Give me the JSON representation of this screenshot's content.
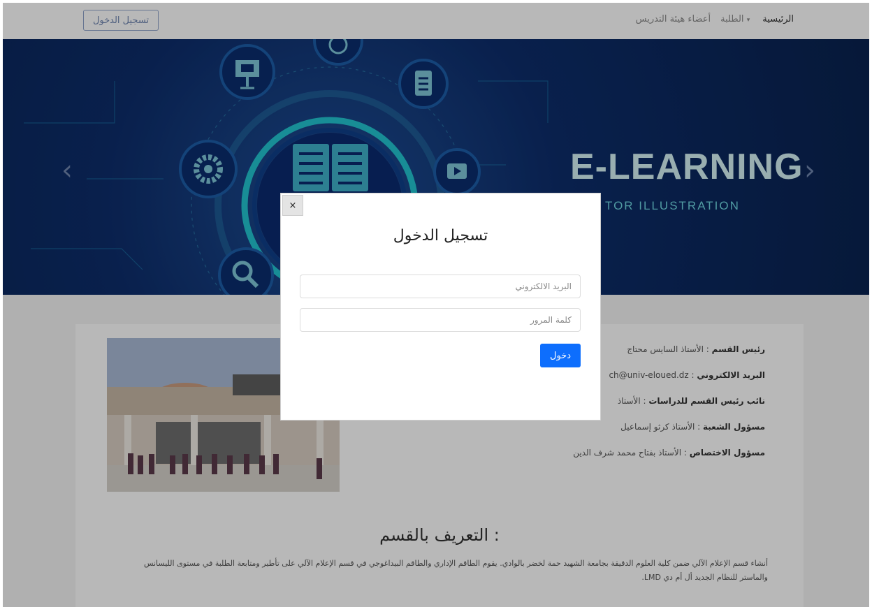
{
  "navbar": {
    "login_label": "تسجيل الدخول",
    "links": [
      {
        "label": "الرئيسية"
      },
      {
        "label": "الطلبة"
      },
      {
        "label": "أعضاء هيئة التدريس"
      }
    ],
    "caret": "▾"
  },
  "banner": {
    "title": "E-LEARNING",
    "subtitle": "TOR ILLUSTRATION",
    "prev_arrow": "‹",
    "next_arrow": "›"
  },
  "staff": [
    {
      "role": "رئيس القسم",
      "value": " : الأستاذ السايس محتاج"
    },
    {
      "role": "البريد الالكتروني",
      "value": " : ch@univ-eloued.dz"
    },
    {
      "role": "نائب رئيس القسم للدراسات",
      "value": " : الأستاذ"
    },
    {
      "role": "مسؤول الشعبة",
      "value": " : الأستاذ كرثو إسماعيل"
    },
    {
      "role": "مسؤول الاختصاص",
      "value": " : الأستاذ بفتاح محمد شرف الدين"
    }
  ],
  "about": {
    "title": "التعريف بالقسم :",
    "text": "أنشاء قسم الإعلام الآلي ضمن كلية العلوم الدقيقة بجامعة الشهيد حمة لخضر بالوادي. يقوم الطاقم الإداري والطاقم البيداغوجي في قسم الإعلام الآلي على تأطير ومتابعة الطلبة في مستوى الليسانس والماستر للنظام الجديد أل أم دي LMD."
  },
  "modal": {
    "close_glyph": "×",
    "title": "تسجيل الدخول",
    "email_placeholder": "البريد الالكتروني",
    "email_value": "",
    "password_placeholder": "كلمة المرور",
    "password_value": "",
    "submit_label": "دخول"
  },
  "colors": {
    "accent": "#0d6efd",
    "banner_bg": "#0d2d6b",
    "banner_title": "#d4f1f4",
    "overlay": "rgba(0,0,0,0.28)"
  },
  "icons": [
    "presentation-icon",
    "globe-icon",
    "clipboard-icon",
    "gear-icon",
    "book-icon",
    "video-play-icon",
    "search-icon",
    "close-icon"
  ]
}
